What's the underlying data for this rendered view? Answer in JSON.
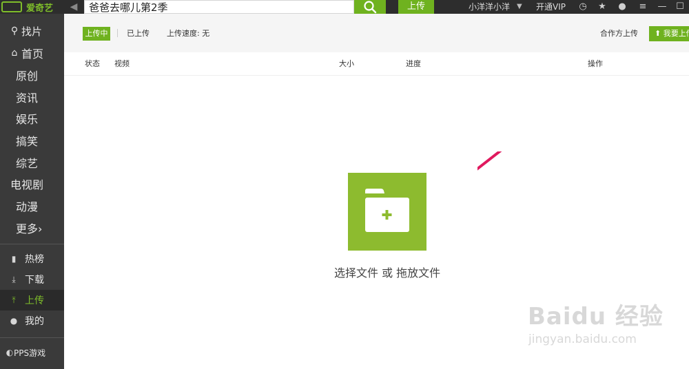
{
  "app": {
    "brand": "爱奇艺"
  },
  "topbar": {
    "search_value": "爸爸去哪儿第2季",
    "upload_label": "上传",
    "username": "小洋洋小洋",
    "vip_label": "开通VIP",
    "accent_color": "#6fb21f"
  },
  "sidebar": {
    "find_label": "找片",
    "home_label": "首页",
    "channels": [
      "原创",
      "资讯",
      "娱乐",
      "搞笑",
      "综艺",
      "电视剧",
      "动漫",
      "更多›"
    ],
    "tools": [
      {
        "label": "热榜",
        "icon": "chart-bars-icon"
      },
      {
        "label": "下载",
        "icon": "download-icon"
      },
      {
        "label": "上传",
        "icon": "upload-icon",
        "active": true
      },
      {
        "label": "我的",
        "icon": "user-icon"
      }
    ],
    "games_label": "PPS游戏"
  },
  "toolbar": {
    "tab_uploading": "上传中",
    "tab_uploaded": "已上传",
    "speed_label": "上传速度: 无",
    "partner_upload": "合作方上传",
    "want_upload": "我要上传"
  },
  "table": {
    "columns": [
      "状态",
      "视频",
      "大小",
      "进度",
      "操作"
    ]
  },
  "dropzone": {
    "text": "选择文件 或 拖放文件",
    "color": "#8dbb2f"
  },
  "watermark": {
    "logo": "Baidu 经验",
    "url": "jingyan.baidu.com"
  }
}
